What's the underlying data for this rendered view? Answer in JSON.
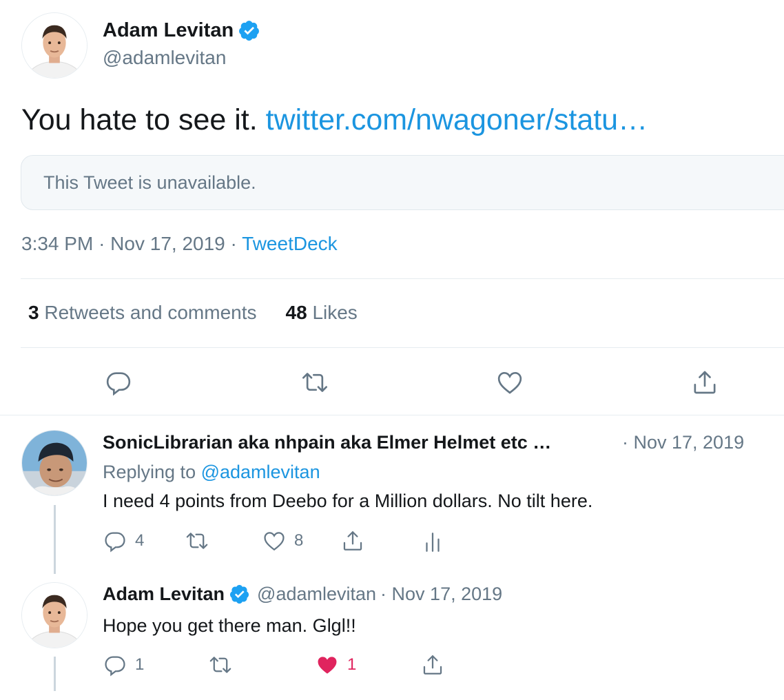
{
  "tweet": {
    "author_name": "Adam Levitan",
    "author_handle": "@adamlevitan",
    "text": "You hate to see it. ",
    "link_text": "twitter.com/nwagoner/statu…",
    "quoted_unavailable": "This Tweet is unavailable.",
    "time": "3:34 PM",
    "date": "Nov 17, 2019",
    "source": "TweetDeck",
    "retweets_count": "3",
    "retweets_label": "Retweets and comments",
    "likes_count": "48",
    "likes_label": "Likes"
  },
  "replies": [
    {
      "author_name": "SonicLibrarian aka nhpain aka Elmer Helmet etc …",
      "date": "· Nov 17, 2019",
      "replying_prefix": "Replying to ",
      "replying_handle": "@adamlevitan",
      "text": "I need 4 points from Deebo for a Million dollars. No tilt here.",
      "reply_count": "4",
      "like_count": "8"
    },
    {
      "author_name": "Adam Levitan",
      "author_handle": "@adamlevitan",
      "date": "· Nov 17, 2019",
      "text": "Hope you get there man. Glgl!!",
      "reply_count": "1",
      "like_count": "1"
    }
  ],
  "colors": {
    "link": "#1b95e0",
    "secondary": "#657786",
    "verified": "#1da1f2",
    "like": "#e0245e"
  },
  "icons": [
    "verified-badge-icon",
    "reply-icon",
    "retweet-icon",
    "like-icon",
    "share-icon",
    "analytics-icon"
  ]
}
